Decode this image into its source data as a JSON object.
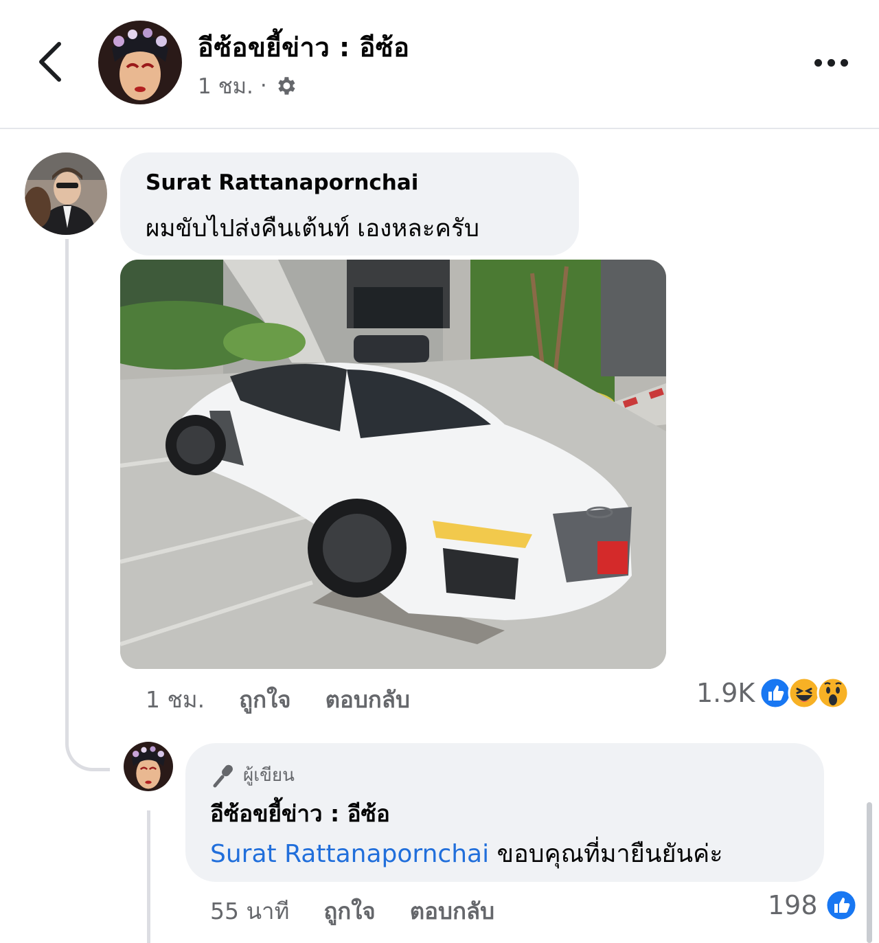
{
  "header": {
    "page_name": "อีซ้อขยี้ข่าว : อีซ้อ",
    "time": "1 ชม.",
    "separator": "·",
    "icons": {
      "back": "back-arrow-icon",
      "privacy": "gear-icon",
      "more": "more-options-icon"
    }
  },
  "comment": {
    "author": "Surat Rattanapornchai",
    "text": "ผมขับไปส่งคืนเต้นท์ เองหละครับ",
    "time": "1 ชม.",
    "like_label": "ถูกใจ",
    "reply_label": "ตอบกลับ",
    "reaction_count": "1.9K",
    "reactions": [
      "like",
      "haha",
      "wow"
    ]
  },
  "reply": {
    "badge": "ผู้เขียน",
    "author": "อีซ้อขยี้ข่าว : อีซ้อ",
    "mention": "Surat Rattanapornchai",
    "text": " ขอบคุณที่มายืนยันค่ะ",
    "time": "55 นาที",
    "like_label": "ถูกใจ",
    "reply_label": "ตอบกลับ",
    "reaction_count": "198",
    "reactions": [
      "like"
    ]
  },
  "colors": {
    "like_blue": "#1877f2",
    "link_blue": "#216fdb",
    "bubble": "#f0f2f5",
    "muted": "#65676b",
    "haha_yellow": "#f7b125"
  }
}
